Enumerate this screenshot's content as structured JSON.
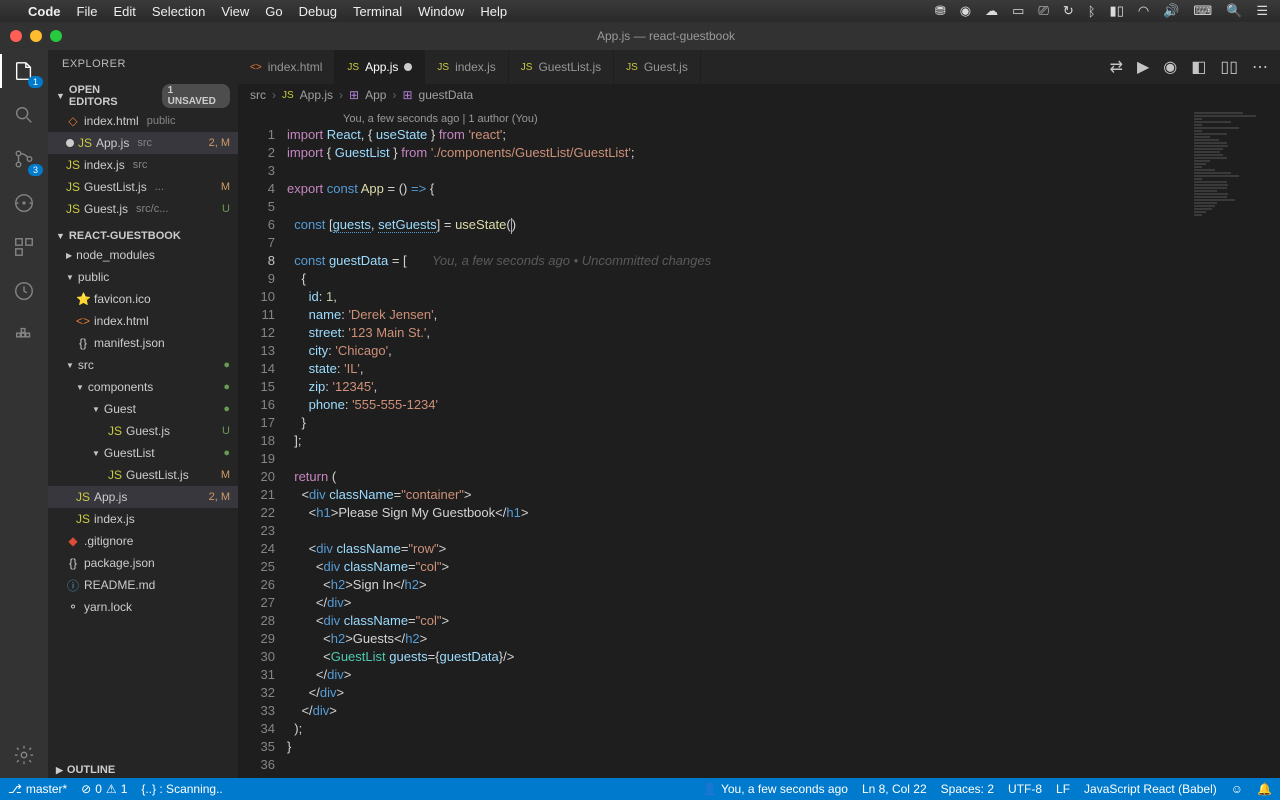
{
  "menubar": {
    "app": "Code",
    "items": [
      "File",
      "Edit",
      "Selection",
      "View",
      "Go",
      "Debug",
      "Terminal",
      "Window",
      "Help"
    ]
  },
  "window_title": "App.js — react-guestbook",
  "activity": {
    "explorer_badge": "1",
    "scm_badge": "3"
  },
  "sidebar": {
    "title": "EXPLORER",
    "open_editors": {
      "label": "OPEN EDITORS",
      "badge": "1 UNSAVED",
      "items": [
        {
          "name": "index.html",
          "dim": "public"
        },
        {
          "name": "App.js",
          "dim": "src",
          "status": "2, M",
          "active": true,
          "modified": true
        },
        {
          "name": "index.js",
          "dim": "src"
        },
        {
          "name": "GuestList.js",
          "dim": "...",
          "status": "M"
        },
        {
          "name": "Guest.js",
          "dim": "src/c...",
          "status": "U"
        }
      ]
    },
    "project": {
      "label": "REACT-GUESTBOOK",
      "tree": [
        {
          "name": "node_modules",
          "type": "folder",
          "indent": 0
        },
        {
          "name": "public",
          "type": "folder",
          "indent": 0,
          "open": true
        },
        {
          "name": "favicon.ico",
          "type": "file",
          "indent": 1,
          "icon": "⭐"
        },
        {
          "name": "index.html",
          "type": "file",
          "indent": 1,
          "icon": "<>",
          "iconc": "orange"
        },
        {
          "name": "manifest.json",
          "type": "file",
          "indent": 1,
          "icon": "{}"
        },
        {
          "name": "src",
          "type": "folder",
          "indent": 0,
          "open": true,
          "dot": true
        },
        {
          "name": "components",
          "type": "folder",
          "indent": 1,
          "open": true,
          "dot": true
        },
        {
          "name": "Guest",
          "type": "folder",
          "indent": 2,
          "open": true,
          "dot": true
        },
        {
          "name": "Guest.js",
          "type": "file",
          "indent": 3,
          "icon": "JS",
          "iconc": "yellow",
          "status": "U"
        },
        {
          "name": "GuestList",
          "type": "folder",
          "indent": 2,
          "open": true,
          "dot": true
        },
        {
          "name": "GuestList.js",
          "type": "file",
          "indent": 3,
          "icon": "JS",
          "iconc": "yellow",
          "status": "M"
        },
        {
          "name": "App.js",
          "type": "file",
          "indent": 1,
          "icon": "JS",
          "iconc": "yellow",
          "status": "2, M",
          "active": true
        },
        {
          "name": "index.js",
          "type": "file",
          "indent": 1,
          "icon": "JS",
          "iconc": "yellow"
        },
        {
          "name": ".gitignore",
          "type": "file",
          "indent": 0,
          "icon": "◆",
          "iconc": "git"
        },
        {
          "name": "package.json",
          "type": "file",
          "indent": 0,
          "icon": "{}"
        },
        {
          "name": "README.md",
          "type": "file",
          "indent": 0,
          "icon": "ⓘ",
          "iconc": "blue"
        },
        {
          "name": "yarn.lock",
          "type": "file",
          "indent": 0,
          "icon": "⚬"
        }
      ]
    },
    "outline": "OUTLINE"
  },
  "tabs": [
    {
      "label": "index.html",
      "icon": "<>",
      "iconc": "orange"
    },
    {
      "label": "App.js",
      "icon": "JS",
      "iconc": "yellow",
      "active": true,
      "modified": true
    },
    {
      "label": "index.js",
      "icon": "JS",
      "iconc": "yellow"
    },
    {
      "label": "GuestList.js",
      "icon": "JS",
      "iconc": "yellow"
    },
    {
      "label": "Guest.js",
      "icon": "JS",
      "iconc": "yellow"
    }
  ],
  "breadcrumb": [
    "src",
    "App.js",
    "App",
    "guestData"
  ],
  "codelens": "You, a few seconds ago | 1 author (You)",
  "code": {
    "ghost": "You, a few seconds ago • Uncommitted changes"
  },
  "statusbar": {
    "branch": "master*",
    "errors": "0",
    "warnings": "1",
    "scanning": "{..} : Scanning..",
    "blame": "You, a few seconds ago",
    "pos": "Ln 8, Col 22",
    "spaces": "Spaces: 2",
    "enc": "UTF-8",
    "eol": "LF",
    "lang": "JavaScript React (Babel)"
  }
}
